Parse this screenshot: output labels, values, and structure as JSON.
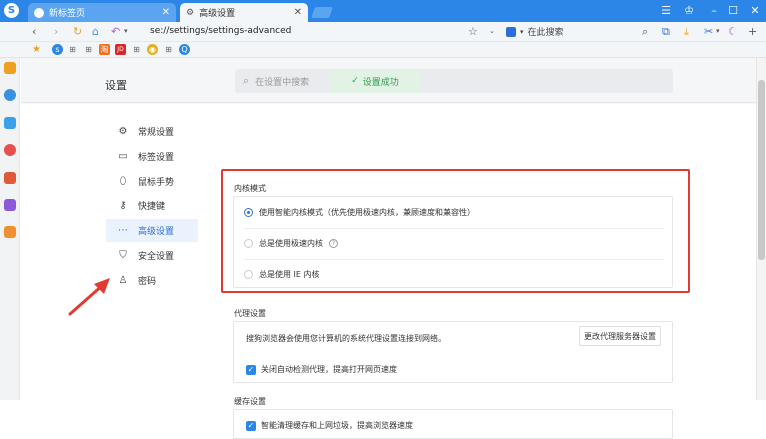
{
  "tabs": [
    {
      "label": "新标签页",
      "active": false
    },
    {
      "label": "高级设置",
      "active": true
    }
  ],
  "address": {
    "url": "se://settings/settings-advanced",
    "search_placeholder": "在此搜索"
  },
  "settings": {
    "title": "设置",
    "search_placeholder": "在设置中搜索",
    "toast": "设置成功"
  },
  "nav": [
    {
      "label": "常规设置",
      "icon": "gear-icon"
    },
    {
      "label": "标签设置",
      "icon": "tab-icon"
    },
    {
      "label": "鼠标手势",
      "icon": "mouse-icon"
    },
    {
      "label": "快捷键",
      "icon": "key-icon"
    },
    {
      "label": "高级设置",
      "icon": "more-icon",
      "active": true
    },
    {
      "label": "安全设置",
      "icon": "shield-icon"
    },
    {
      "label": "密码",
      "icon": "user-icon"
    }
  ],
  "kernel": {
    "title": "内核模式",
    "options": [
      {
        "label": "使用智能内核模式（优先使用极速内核，兼顾速度和兼容性）",
        "selected": true
      },
      {
        "label": "总是使用极速内核",
        "selected": false
      },
      {
        "label": "总是使用 IE 内核",
        "selected": false
      }
    ]
  },
  "proxy": {
    "title": "代理设置",
    "description": "搜狗浏览器会使用您计算机的系统代理设置连接到网络。",
    "button": "更改代理服务器设置",
    "checkbox": "关闭自动检测代理，提高打开网页速度"
  },
  "cache": {
    "title": "缓存设置",
    "checkbox": "智能清理缓存和上网垃圾，提高浏览器速度"
  },
  "colors": {
    "accent": "#2c86e8",
    "highlight": "#e03a32",
    "success": "#2f9a50"
  }
}
